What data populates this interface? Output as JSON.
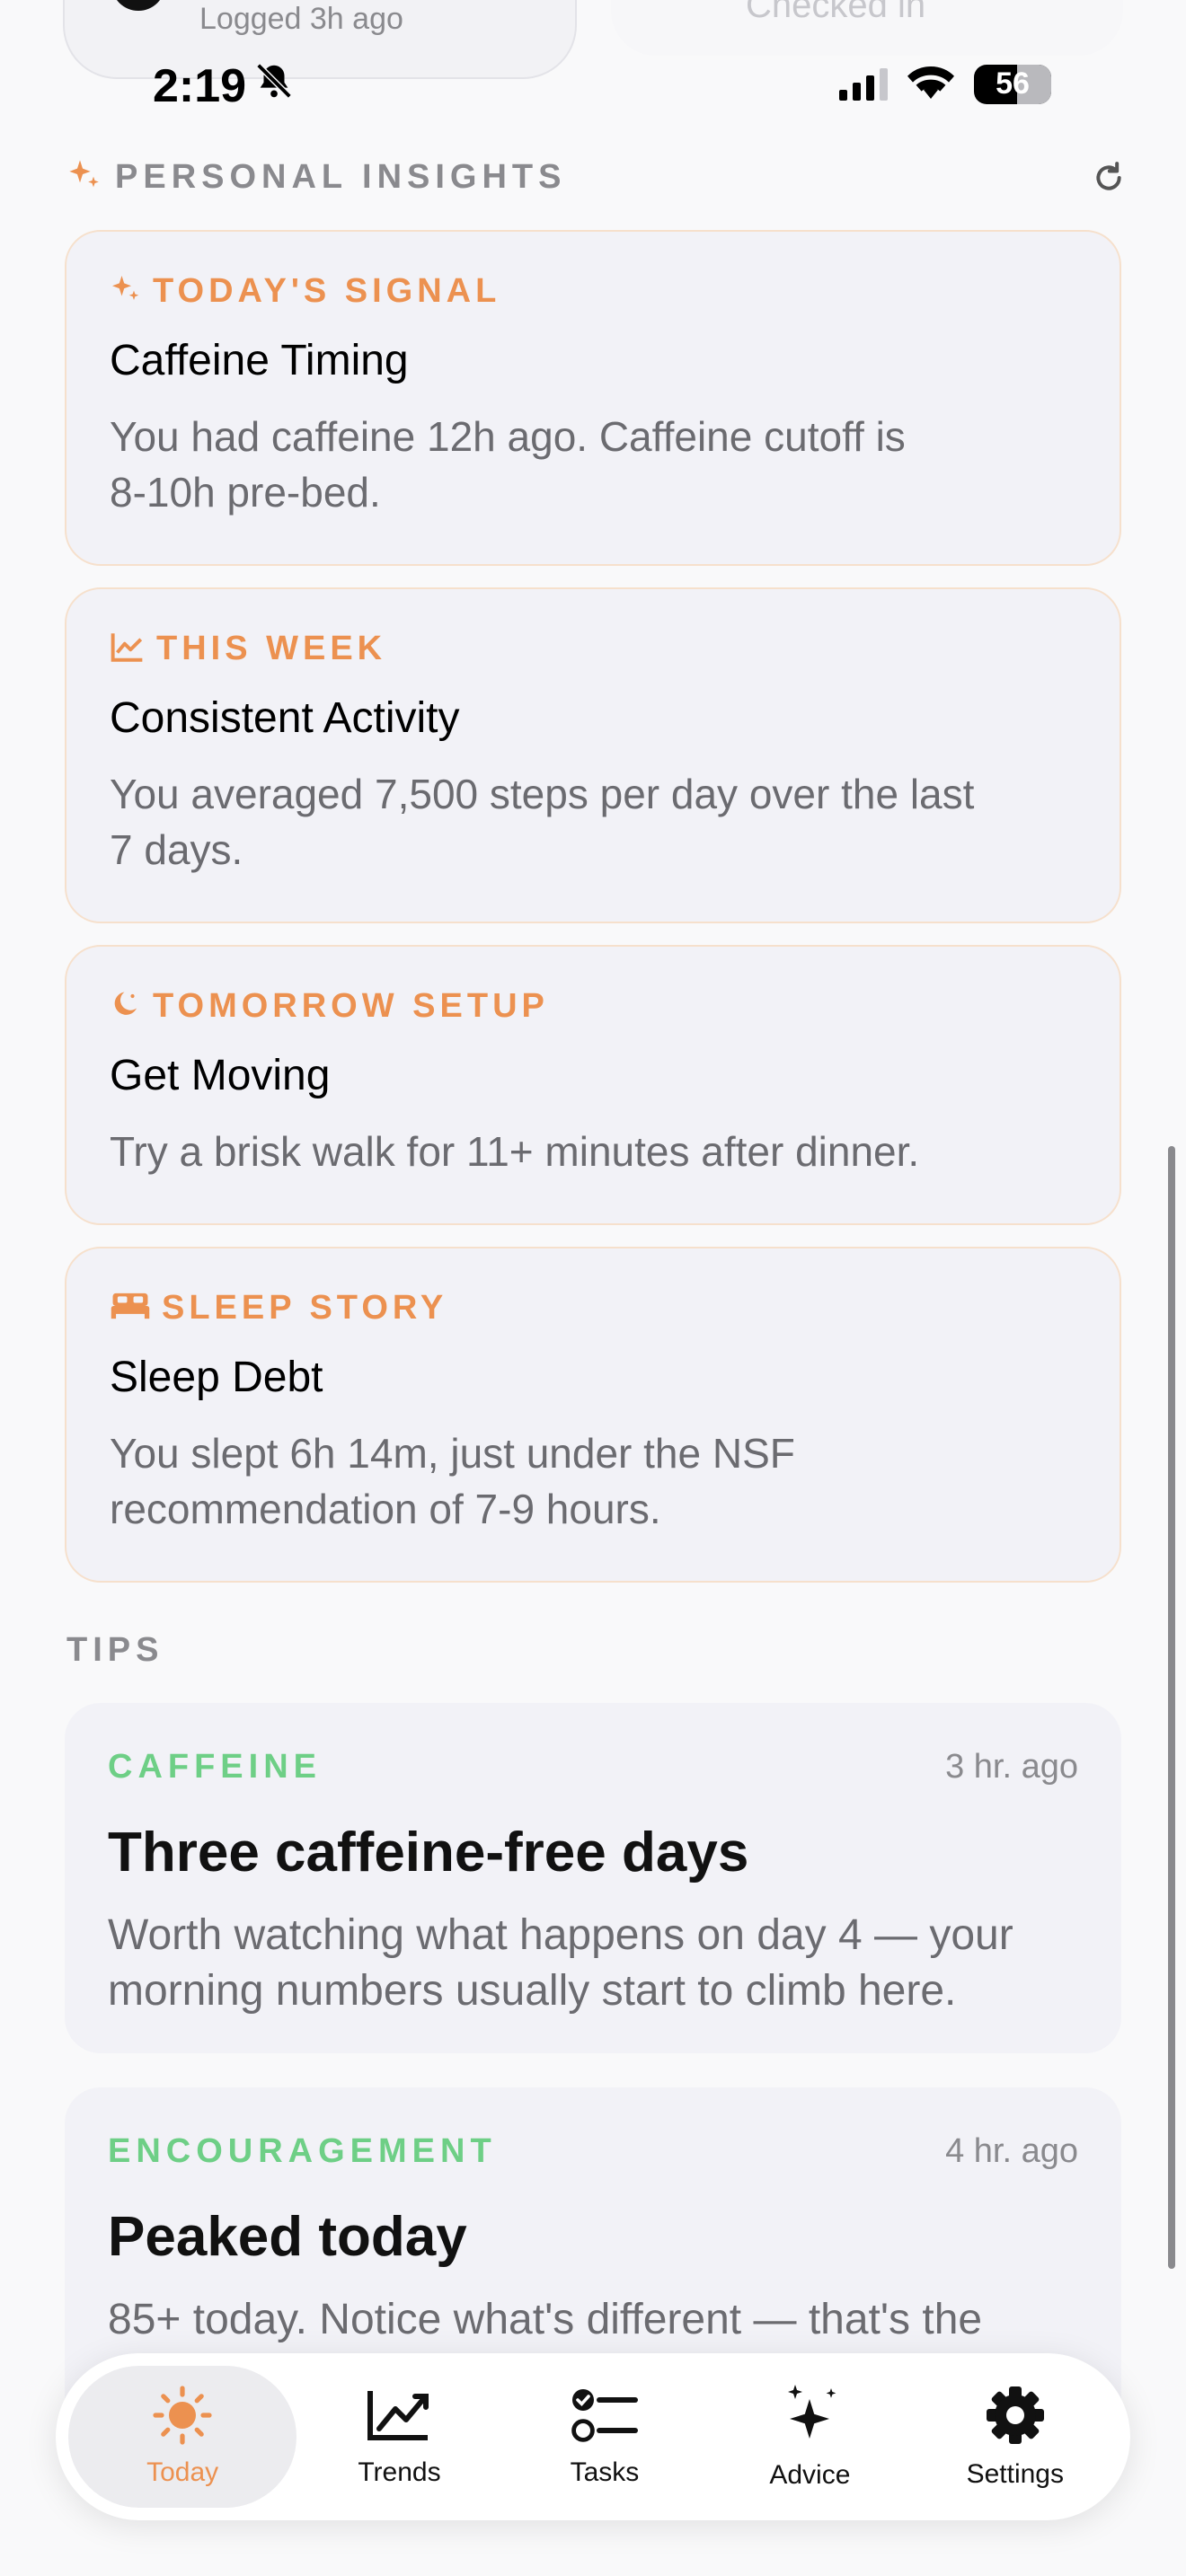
{
  "top_remnant": {
    "logged_text": "Logged 3h ago",
    "checked_text": "Checked in"
  },
  "status_bar": {
    "time": "2:19",
    "battery": "56"
  },
  "insights_section": {
    "title": "PERSONAL INSIGHTS",
    "cards": [
      {
        "label": "TODAY'S SIGNAL",
        "icon": "sparkle-icon",
        "title": "Caffeine Timing",
        "body_line1": "You had caffeine 12h ago. Caffeine cutoff is",
        "body_line2": "8-10h pre-bed."
      },
      {
        "label": "THIS WEEK",
        "icon": "trend-chart-icon",
        "title": "Consistent Activity",
        "body_line1": "You averaged 7,500 steps per day over the last",
        "body_line2": "7 days."
      },
      {
        "label": "TOMORROW SETUP",
        "icon": "moon-icon",
        "title": "Get Moving",
        "body_line1": "Try a brisk walk for 11+ minutes after dinner."
      },
      {
        "label": "SLEEP STORY",
        "icon": "bed-icon",
        "title": "Sleep Debt",
        "body_line1": "You slept 6h 14m, just under the NSF",
        "body_line2": "recommendation of 7-9 hours."
      }
    ]
  },
  "tips_section": {
    "title": "TIPS",
    "tips": [
      {
        "category": "CAFFEINE",
        "time": "3 hr. ago",
        "title": "Three caffeine-free days",
        "body_line1": "Worth watching what happens on day 4 — your",
        "body_line2": "morning numbers usually start to climb here."
      },
      {
        "category": "ENCOURAGEMENT",
        "time": "4 hr. ago",
        "title": "Peaked today",
        "body_line1": "85+ today. Notice what's different — that's the"
      }
    ]
  },
  "tab_bar": {
    "tabs": [
      {
        "label": "Today",
        "icon": "sun-icon",
        "active": true
      },
      {
        "label": "Trends",
        "icon": "trends-icon"
      },
      {
        "label": "Tasks",
        "icon": "tasks-icon"
      },
      {
        "label": "Advice",
        "icon": "sparkles-icon"
      },
      {
        "label": "Settings",
        "icon": "gear-icon"
      }
    ]
  },
  "colors": {
    "accent_orange": "#ec9150",
    "tip_green": "#6ecf86",
    "card_bg": "#f2f2f7",
    "card_border": "#f6e0cc"
  }
}
